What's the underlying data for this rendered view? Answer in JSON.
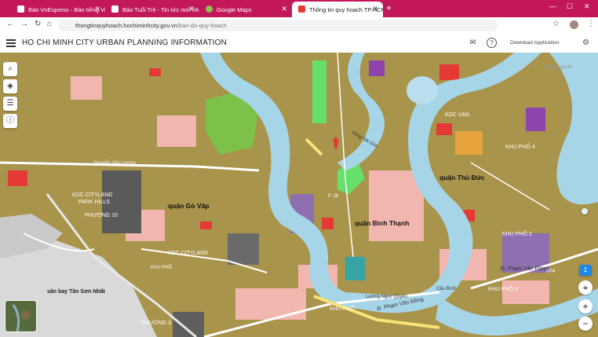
{
  "browser": {
    "tabs": [
      {
        "title": "Báo VnExpress - Báo tiếng Việt",
        "favicon_color": "#c2185b"
      },
      {
        "title": "Báo Tuổi Trẻ - Tin tức mới nhất",
        "favicon_color": "#e53935"
      },
      {
        "title": "Google Maps",
        "favicon_color": "#34a853"
      },
      {
        "title": "Thông tin quy hoạch TP.HCM",
        "favicon_color": "#e53935"
      }
    ],
    "new_tab": "+",
    "url_domain": "thongtinquyhoach.hochiminhcity.gov.vn",
    "url_path": "/ban-do-quy-hoach"
  },
  "app": {
    "title": "HO CHI MINH CITY URBAN PLANNING INFORMATION",
    "download_label": "Download Application"
  },
  "watermark": "Batdongsan",
  "map_labels": {
    "district_go_vap": "quận Gò Vấp",
    "district_binh_thanh": "quận Bình Thạnh",
    "district_thu_duc": "quận Thủ Đức",
    "airport": "sân bay Tân Sơn Nhất",
    "kdc_cityland": "KDC CITYLAND",
    "park_hills": "PARK HILLS",
    "phuong_10": "PHƯỜNG 10",
    "kdc_van_phuc": "KDC VẠN",
    "khu_pho_4": "KHU PHỐ 4",
    "khu_pho_2": "KHU PHỐ 2",
    "khu_pho_3": "KHU PHỐ 3",
    "khu_pho_1": "KHU PHỐ",
    "phuong_3": "PHƯỜNG 3",
    "kdc_cityland2": "KDC CITYLAND",
    "pham_van_dong": "Đ. Phạm Văn Đồng",
    "pham_van_dong2": "Đ. Phạm Văn Đồng",
    "luong_ngoc_quyen": "Lương Ngọc Quyến",
    "cau_binh": "Cầu Bình",
    "song_sai_gon": "Sông Sài Gòn",
    "nguyen_van_luong": "Nguyễn Văn Lượng",
    "phuong_26": "P. 26",
    "kp4": "KP4",
    "khu_pho_a": "KHU PHỐ"
  },
  "zoom_controls": {
    "layer": "1",
    "plus": "+",
    "minus": "−"
  }
}
